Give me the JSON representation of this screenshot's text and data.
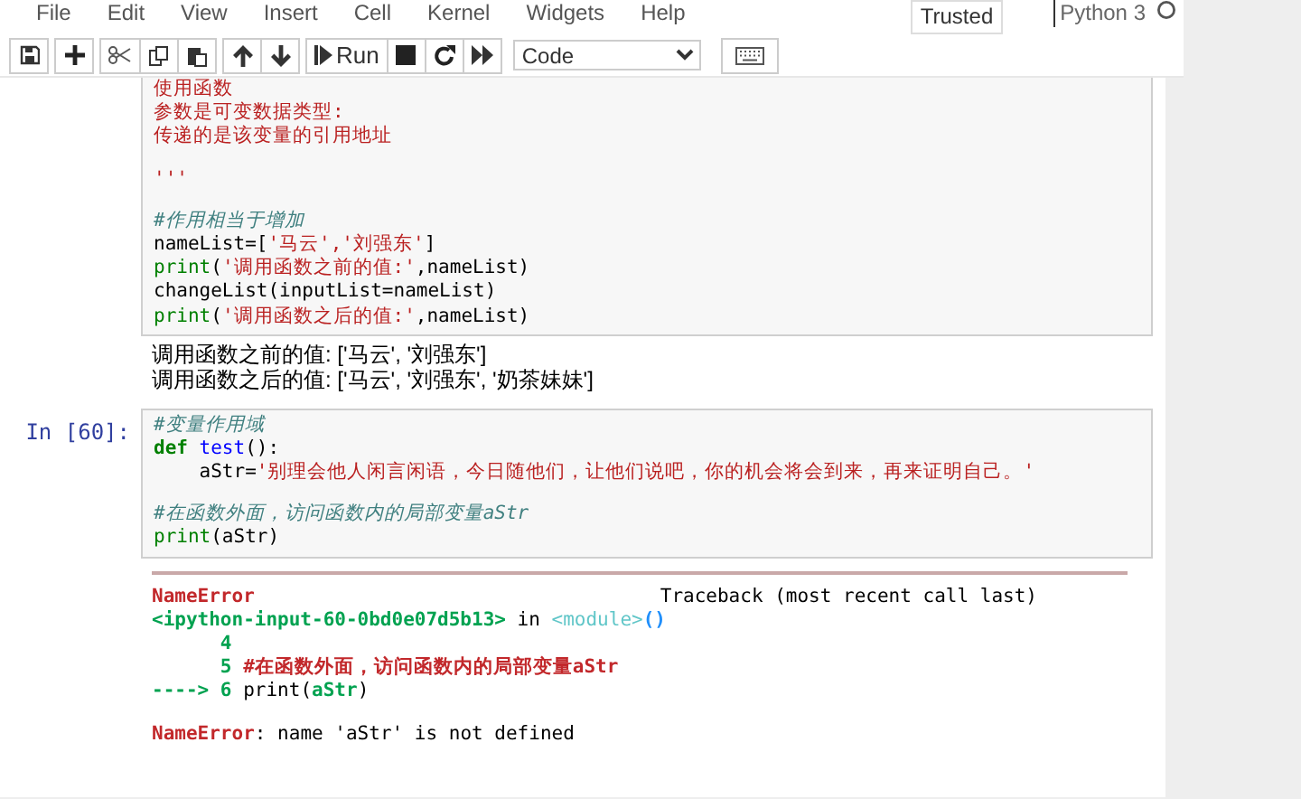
{
  "menu": [
    "File",
    "Edit",
    "View",
    "Insert",
    "Cell",
    "Kernel",
    "Widgets",
    "Help"
  ],
  "trusted": "Trusted",
  "kernel": {
    "name": "Python 3",
    "idle": true
  },
  "toolbar": {
    "run_label": "Run",
    "cell_type": "Code"
  },
  "cells": [
    {
      "lines": [
        {
          "tokens": [
            {
              "kind": "string",
              "text": "使用函数"
            }
          ]
        },
        {
          "tokens": [
            {
              "kind": "string",
              "text": "参数是可变数据类型:"
            }
          ]
        },
        {
          "tokens": [
            {
              "kind": "string",
              "text": "传递的是该变量的引用地址"
            }
          ]
        },
        {
          "kind": "blank"
        },
        {
          "tokens": [
            {
              "kind": "string",
              "text": "'''"
            }
          ]
        },
        {
          "kind": "blank"
        },
        {
          "tokens": [
            {
              "kind": "comment",
              "text": "#作用相当于增加"
            }
          ]
        },
        {
          "tokens": [
            {
              "kind": "plain",
              "text": "nameList=["
            },
            {
              "kind": "string",
              "text": "'马云','刘强东'"
            },
            {
              "kind": "plain",
              "text": "]"
            }
          ]
        },
        {
          "tokens": [
            {
              "kind": "builtin",
              "text": "print"
            },
            {
              "kind": "plain",
              "text": "("
            },
            {
              "kind": "string",
              "text": "'调用函数之前的值:'"
            },
            {
              "kind": "plain",
              "text": ",nameList)"
            }
          ]
        },
        {
          "tokens": [
            {
              "kind": "plain",
              "text": "changeList(inputList=nameList)"
            }
          ]
        },
        {
          "tokens": [
            {
              "kind": "builtin",
              "text": "print"
            },
            {
              "kind": "plain",
              "text": "("
            },
            {
              "kind": "string",
              "text": "'调用函数之后的值:'"
            },
            {
              "kind": "plain",
              "text": ",nameList)"
            }
          ]
        }
      ],
      "output": {
        "kind": "stream",
        "lines": [
          "调用函数之前的值: ['马云', '刘强东']",
          "调用函数之后的值: ['马云', '刘强东', '奶茶妹妹']"
        ]
      }
    },
    {
      "prompt": "In [60]:",
      "lines": [
        {
          "tokens": [
            {
              "kind": "comment",
              "text": "#变量作用域"
            }
          ]
        },
        {
          "tokens": [
            {
              "kind": "keyword",
              "text": "def"
            },
            {
              "kind": "name",
              "text": " test"
            },
            {
              "kind": "plain",
              "text": "():"
            }
          ]
        },
        {
          "tokens": [
            {
              "kind": "plain",
              "text": "    aStr="
            },
            {
              "kind": "string",
              "text": "'别理会他人闲言闲语，今日随他们，让他们说吧，你的机会将会到来，再来证明自己。'"
            }
          ]
        },
        {
          "kind": "blank"
        },
        {
          "tokens": [
            {
              "kind": "comment",
              "text": "#在函数外面，访问函数内的局部变量aStr"
            }
          ]
        },
        {
          "tokens": [
            {
              "kind": "builtin",
              "text": "print"
            },
            {
              "kind": "plain",
              "text": "(aStr)"
            }
          ]
        }
      ],
      "output": {
        "kind": "error",
        "error_name": "NameError",
        "traceback_label": "Traceback (most recent call last)",
        "lines": [
          {
            "tokens": [
              {
                "kind": "green",
                "text": "<ipython-input-60-0bd0e07d5b13>"
              },
              {
                "kind": "plain",
                "text": " in "
              },
              {
                "kind": "cyan",
                "text": "<module>"
              },
              {
                "kind": "blue",
                "text": "()"
              }
            ]
          },
          {
            "tokens": [
              {
                "kind": "green",
                "text": "      4"
              }
            ]
          },
          {
            "tokens": [
              {
                "kind": "green",
                "text": "      5 "
              },
              {
                "kind": "red",
                "text": "#在函数外面，访问函数内的局部变量aStr"
              }
            ]
          },
          {
            "tokens": [
              {
                "kind": "green",
                "text": "----> 6 "
              },
              {
                "kind": "plain",
                "text": "print"
              },
              {
                "kind": "plain",
                "text": "("
              },
              {
                "kind": "green",
                "text": "aStr"
              },
              {
                "kind": "plain",
                "text": ")"
              }
            ]
          },
          {
            "kind": "blank"
          },
          {
            "tokens": [
              {
                "kind": "red",
                "text": "NameError"
              },
              {
                "kind": "plain",
                "text": ": name 'aStr' is not defined"
              }
            ]
          }
        ]
      }
    }
  ]
}
